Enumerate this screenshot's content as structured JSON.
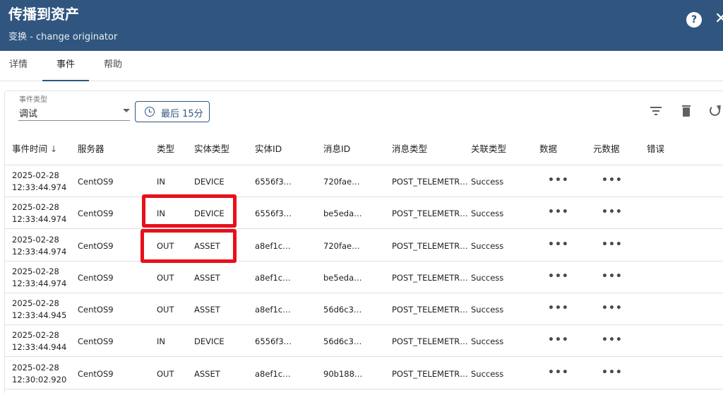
{
  "header": {
    "title": "传播到资产",
    "subtitle": "变换 - change originator",
    "help_label": "?",
    "close_label": "✕"
  },
  "tabs": [
    {
      "label": "详情",
      "active": false
    },
    {
      "label": "事件",
      "active": true
    },
    {
      "label": "帮助",
      "active": false
    }
  ],
  "filter": {
    "event_type_label": "事件类型",
    "event_type_value": "调试",
    "time_button_label": "最后 15分"
  },
  "columns": [
    "事件时间",
    "服务器",
    "类型",
    "实体类型",
    "实体ID",
    "消息ID",
    "消息类型",
    "关联类型",
    "数据",
    "元数据",
    "错误"
  ],
  "rows": [
    {
      "date": "2025-02-28",
      "time": "12:33:44.974",
      "server": "CentOS9",
      "type": "IN",
      "entity_type": "DEVICE",
      "entity_id": "6556f3…",
      "msg_id": "720fae…",
      "msg_type": "POST_TELEMETR…",
      "relation": "Success",
      "data": "•••",
      "meta": "•••"
    },
    {
      "date": "2025-02-28",
      "time": "12:33:44.974",
      "server": "CentOS9",
      "type": "IN",
      "entity_type": "DEVICE",
      "entity_id": "6556f3…",
      "msg_id": "be5eda…",
      "msg_type": "POST_TELEMETR…",
      "relation": "Success",
      "data": "•••",
      "meta": "•••"
    },
    {
      "date": "2025-02-28",
      "time": "12:33:44.974",
      "server": "CentOS9",
      "type": "OUT",
      "entity_type": "ASSET",
      "entity_id": "a8ef1c…",
      "msg_id": "720fae…",
      "msg_type": "POST_TELEMETR…",
      "relation": "Success",
      "data": "•••",
      "meta": "•••"
    },
    {
      "date": "2025-02-28",
      "time": "12:33:44.974",
      "server": "CentOS9",
      "type": "OUT",
      "entity_type": "ASSET",
      "entity_id": "a8ef1c…",
      "msg_id": "be5eda…",
      "msg_type": "POST_TELEMETR…",
      "relation": "Success",
      "data": "•••",
      "meta": "•••"
    },
    {
      "date": "2025-02-28",
      "time": "12:33:44.945",
      "server": "CentOS9",
      "type": "OUT",
      "entity_type": "ASSET",
      "entity_id": "a8ef1c…",
      "msg_id": "56d6c3…",
      "msg_type": "POST_TELEMETR…",
      "relation": "Success",
      "data": "•••",
      "meta": "•••"
    },
    {
      "date": "2025-02-28",
      "time": "12:33:44.944",
      "server": "CentOS9",
      "type": "IN",
      "entity_type": "DEVICE",
      "entity_id": "6556f3…",
      "msg_id": "56d6c3…",
      "msg_type": "POST_TELEMETR…",
      "relation": "Success",
      "data": "•••",
      "meta": "•••"
    },
    {
      "date": "2025-02-28",
      "time": "12:30:02.920",
      "server": "CentOS9",
      "type": "OUT",
      "entity_type": "ASSET",
      "entity_id": "a8ef1c…",
      "msg_id": "90b188…",
      "msg_type": "POST_TELEMETR…",
      "relation": "Success",
      "data": "•••",
      "meta": "•••"
    }
  ],
  "colors": {
    "header_bg": "#305680",
    "highlight": "#e8101b"
  },
  "icons": {
    "help": "help-circle-icon",
    "close": "close-icon",
    "clock": "clock-icon",
    "filter": "filter-list-icon",
    "delete": "trash-icon",
    "refresh": "refresh-icon",
    "sort": "arrow-down-icon"
  }
}
